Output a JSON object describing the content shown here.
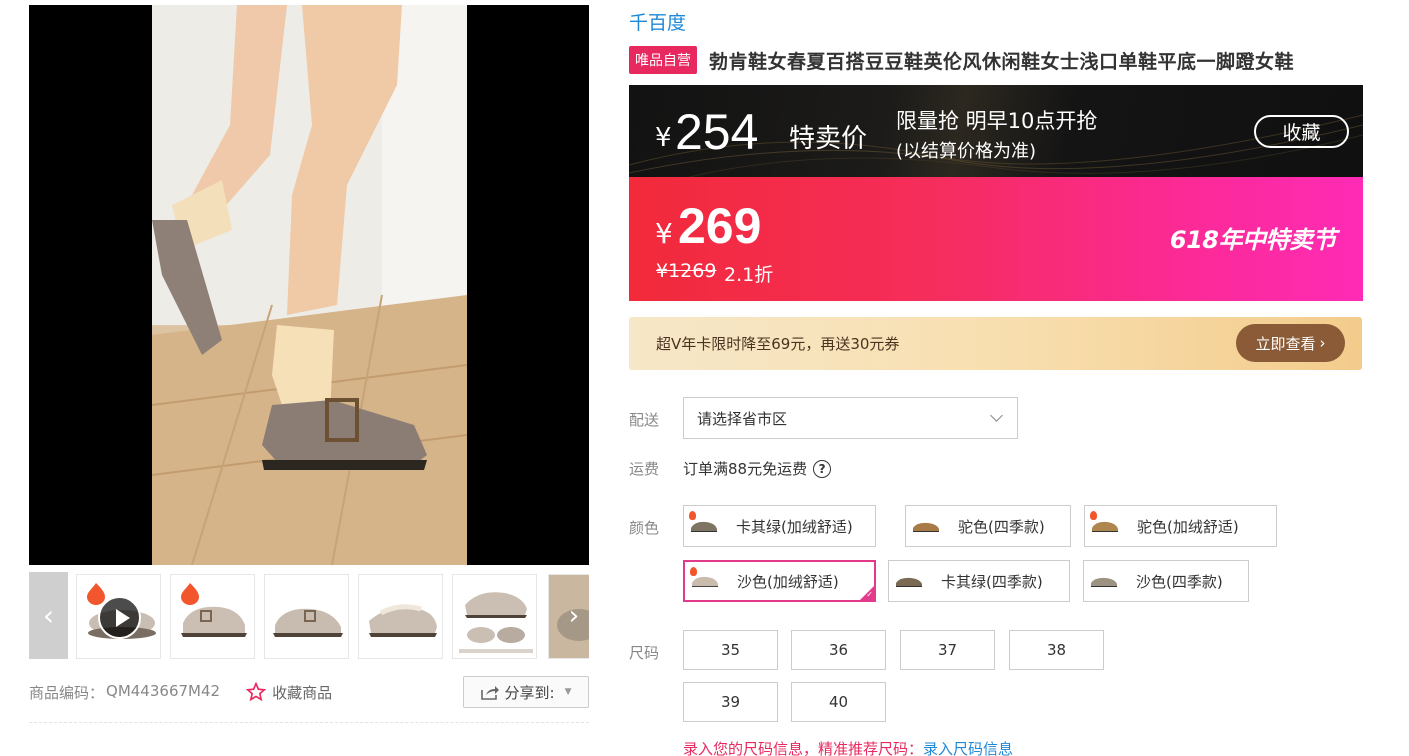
{
  "product": {
    "brand": "千百度",
    "self_tag": "唯品自营",
    "title": "勃肯鞋女春夏百搭豆豆鞋英伦风休闲鞋女士浅口单鞋平底一脚蹬女鞋"
  },
  "flash": {
    "yen": "¥",
    "price": "254",
    "label": "特卖价",
    "flash_text": "限量抢 明早10点开抢",
    "note": "(以结算价格为准)",
    "collect_label": "收藏"
  },
  "price": {
    "yen": "¥",
    "current": "269",
    "original": "¥1269",
    "discount": "2.1折",
    "festival": "618年中特卖节"
  },
  "promo": {
    "text": "超V年卡限时降至69元，再送30元券",
    "button_label": "立即查看",
    "button_arrow": "›"
  },
  "shipping": {
    "label": "配送",
    "placeholder": "请选择省市区",
    "fee_label": "运费",
    "fee_text": "订单满88元免运费",
    "help": "?"
  },
  "colors": {
    "label": "颜色",
    "options": [
      "卡其绿(加绒舒适)",
      "驼色(四季款)",
      "驼色(加绒舒适)",
      "沙色(加绒舒适)",
      "卡其绿(四季款)",
      "沙色(四季款)"
    ],
    "selected": "沙色(加绒舒适)"
  },
  "sizes": {
    "label": "尺码",
    "options": [
      "35",
      "36",
      "37",
      "38",
      "39",
      "40"
    ],
    "hint": "录入您的尺码信息，精准推荐尺码：",
    "hint_link": "录入尺码信息"
  },
  "meta": {
    "code_label": "商品编码：",
    "code": "QM443667M42",
    "fav_label": "收藏商品",
    "share_label": "分享到:"
  },
  "gallery": {
    "prev_arrow": "‹",
    "next_arrow": "›"
  },
  "colors_palette": {
    "accent_pink": "#e8295f",
    "link_blue": "#1e88d8",
    "selected_border": "#e33a8c",
    "promo_button": "#8b5a36"
  }
}
